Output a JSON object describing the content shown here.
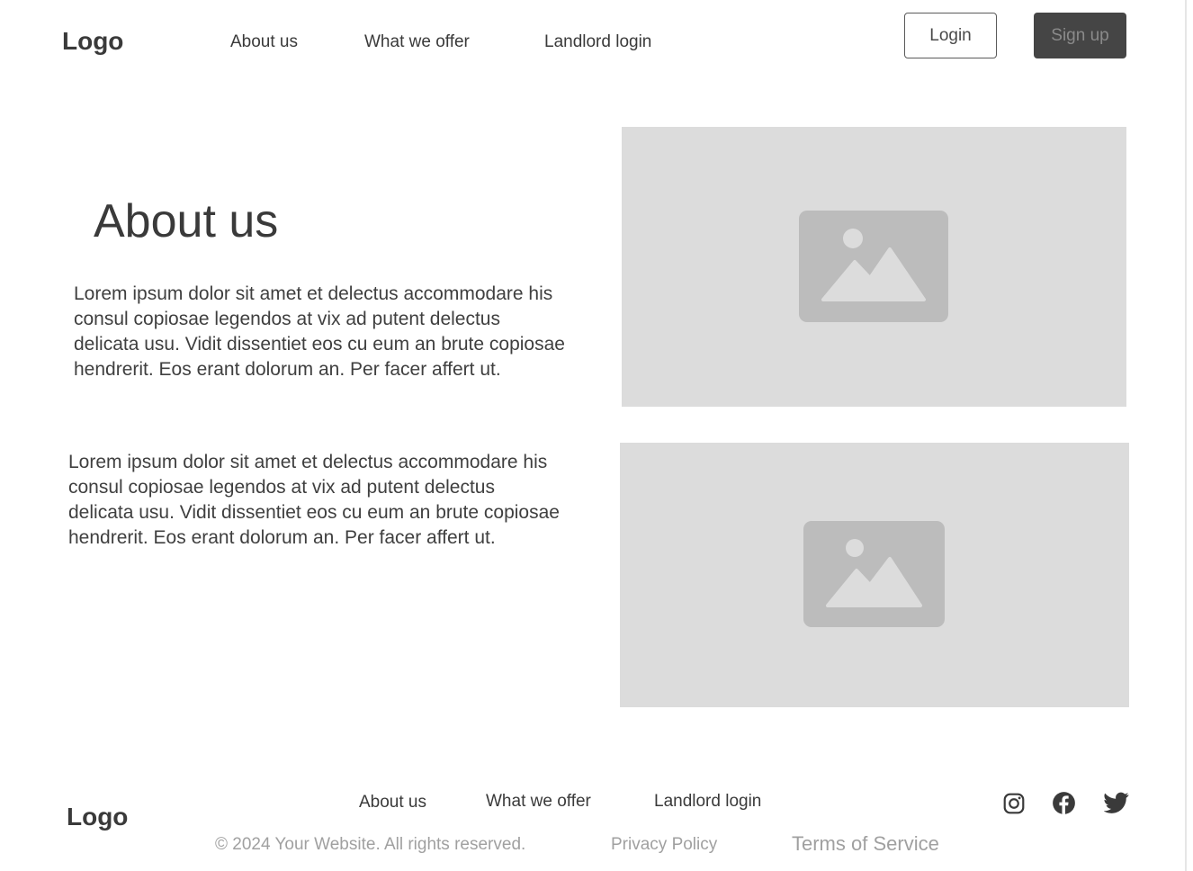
{
  "header": {
    "logo": "Logo",
    "nav": [
      "About us",
      "What we offer",
      "Landlord login"
    ],
    "login_label": "Login",
    "signup_label": "Sign up"
  },
  "main": {
    "heading": "About us",
    "paragraphs": [
      "Lorem ipsum dolor sit amet et delectus accommodare his consul copiosae legendos at vix ad putent delectus delicata usu. Vidit dissentiet eos cu eum an brute copiosae hendrerit. Eos erant dolorum an. Per facer affert ut.",
      "Lorem ipsum dolor sit amet et delectus accommodare his consul copiosae legendos at vix ad putent delectus delicata usu. Vidit dissentiet eos cu eum an brute copiosae hendrerit. Eos erant dolorum an. Per facer affert ut."
    ],
    "images": [
      "image-placeholder-icon",
      "image-placeholder-icon"
    ]
  },
  "footer": {
    "logo": "Logo",
    "nav": [
      "About us",
      "What we offer",
      "Landlord login"
    ],
    "copyright": "© 2024 Your Website. All rights reserved.",
    "privacy": "Privacy Policy",
    "terms": "Terms of Service",
    "social": [
      "instagram-icon",
      "facebook-icon",
      "twitter-icon"
    ]
  },
  "colors": {
    "text": "#3a3a3a",
    "muted": "#a0a0a0",
    "placeholder_bg": "#dcdcdc",
    "placeholder_icon": "#bcbcbc",
    "signup_bg": "#454545"
  }
}
